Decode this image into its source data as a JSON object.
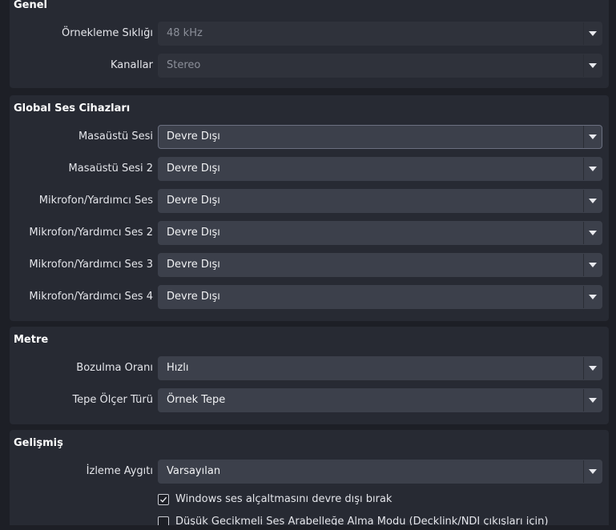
{
  "sections": {
    "general": {
      "title": "Genel",
      "sample_rate_label": "Örnekleme Sıklığı",
      "sample_rate_value": "48 kHz",
      "channels_label": "Kanallar",
      "channels_value": "Stereo"
    },
    "global_devices": {
      "title": "Global Ses Cihazları",
      "rows": [
        {
          "label": "Masaüstü Sesi",
          "value": "Devre Dışı"
        },
        {
          "label": "Masaüstü Sesi 2",
          "value": "Devre Dışı"
        },
        {
          "label": "Mikrofon/Yardımcı Ses",
          "value": "Devre Dışı"
        },
        {
          "label": "Mikrofon/Yardımcı Ses 2",
          "value": "Devre Dışı"
        },
        {
          "label": "Mikrofon/Yardımcı Ses 3",
          "value": "Devre Dışı"
        },
        {
          "label": "Mikrofon/Yardımcı Ses 4",
          "value": "Devre Dışı"
        }
      ]
    },
    "meters": {
      "title": "Metre",
      "decay_label": "Bozulma Oranı",
      "decay_value": "Hızlı",
      "peak_label": "Tepe Ölçer Türü",
      "peak_value": "Örnek Tepe"
    },
    "advanced": {
      "title": "Gelişmiş",
      "monitoring_label": "İzleme Aygıtı",
      "monitoring_value": "Varsayılan",
      "ducking_label": "Windows ses alçaltmasını devre dışı bırak",
      "ducking_checked": true,
      "low_latency_label": "Düşük Gecikmeli Ses Arabelleğe Alma Modu (Decklink/NDI çıkışları için)",
      "low_latency_checked": false
    }
  },
  "colors": {
    "background": "#1d1f26",
    "group_background": "#272a33",
    "combo_background": "#3c404b",
    "text": "#e4e5ea"
  }
}
